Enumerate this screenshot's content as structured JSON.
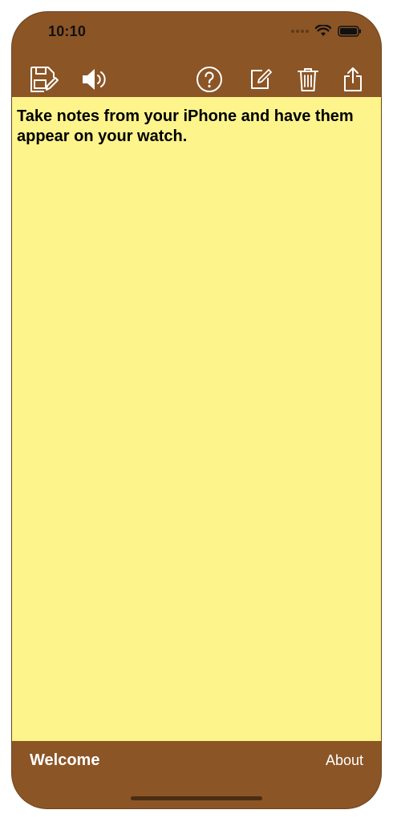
{
  "status_bar": {
    "time": "10:10"
  },
  "toolbar": {
    "items": [
      {
        "name": "save",
        "icon": "save-note-icon"
      },
      {
        "name": "speak",
        "icon": "speaker-icon"
      },
      {
        "name": "help",
        "icon": "help-icon"
      },
      {
        "name": "compose",
        "icon": "compose-icon"
      },
      {
        "name": "delete",
        "icon": "trash-icon"
      },
      {
        "name": "share",
        "icon": "share-icon"
      }
    ]
  },
  "note": {
    "text": "Take notes from your iPhone and have them appear on your watch."
  },
  "tab_bar": {
    "welcome_label": "Welcome",
    "about_label": "About"
  },
  "colors": {
    "bar_brown": "#8b5526",
    "note_yellow": "#fdf48c",
    "icon_white": "#ffffff"
  }
}
